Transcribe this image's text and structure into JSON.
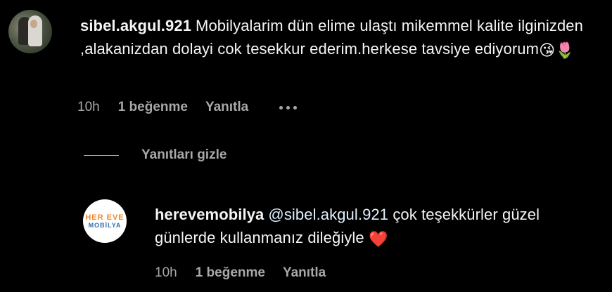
{
  "comments": [
    {
      "username": "sibel.akgul.921",
      "text": "Mobilyalarim dün elime ulaştı mikemmel kalite ilginizden ,alakanizdan dolayi cok tesekkur ederim.herkese tavsiye ediyorum",
      "emojis": "😘🌷",
      "time": "10h",
      "likes": "1 beğenme",
      "reply_label": "Yanıtla",
      "more_icon": "more-dots-icon"
    }
  ],
  "replies_toggle": {
    "label": "Yanıtları gizle"
  },
  "reply": {
    "username": "herevemobilya",
    "mention": "@sibel.akgul.921",
    "text": "çok teşekkürler güzel günlerde kullanmanız dileğiyle",
    "emoji": "❤️",
    "time": "10h",
    "likes": "1 beğenme",
    "reply_label": "Yanıtla",
    "avatar_logo": {
      "top": "HER EVE",
      "bottom": "MOBİLYA"
    }
  },
  "colors": {
    "background": "#000000",
    "text": "#f5f5f5",
    "secondary": "#a8a8a8",
    "mention": "#e0f1ff",
    "logo_orange": "#f08a2b",
    "logo_blue": "#2f6fa8"
  }
}
